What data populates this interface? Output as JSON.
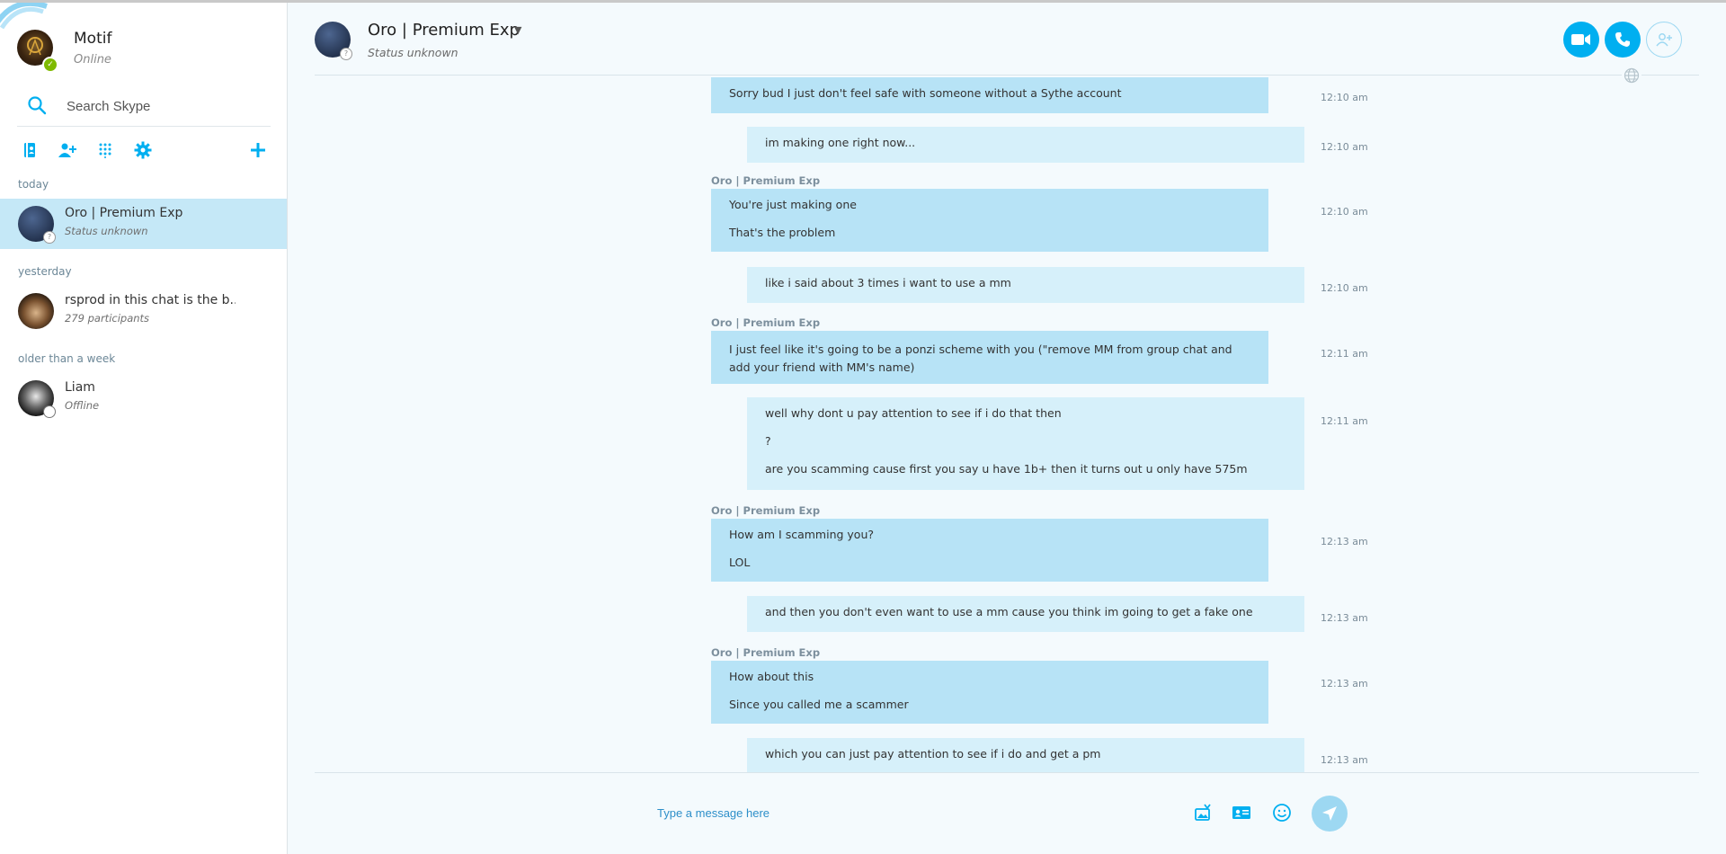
{
  "colors": {
    "accent": "#00aff0",
    "active_row": "#c5e8f7",
    "incoming_bubble": "#b7e3f6",
    "outgoing_bubble": "#d6f0fa",
    "online": "#7fba00"
  },
  "profile": {
    "name": "Motif",
    "status": "Online"
  },
  "search": {
    "placeholder": "Search Skype"
  },
  "toolbar": {
    "icons": [
      "contacts-icon",
      "add-contact-icon",
      "dialpad-icon",
      "settings-icon",
      "plus-icon"
    ]
  },
  "sections": {
    "today": "today",
    "yesterday": "yesterday",
    "older": "older than a week"
  },
  "chats": [
    {
      "name": "Oro | Premium Exp",
      "subtitle": "Status unknown"
    },
    {
      "name": "rsprod in this chat is the b..",
      "subtitle": "279 participants"
    },
    {
      "name": "Liam",
      "subtitle": "Offline"
    }
  ],
  "header": {
    "title": "Oro | Premium Exp",
    "status": "Status unknown"
  },
  "conversation": {
    "sender": "Oro | Premium Exp",
    "messages": [
      {
        "dir": "in",
        "lines": [
          "Sorry bud I just don't feel safe with someone without a Sythe account"
        ],
        "time": "12:10 am"
      },
      {
        "dir": "out",
        "lines": [
          "im making one right now..."
        ],
        "time": "12:10 am"
      },
      {
        "dir": "in",
        "sender": "Oro | Premium Exp",
        "lines": [
          "You're just making one",
          "That's the problem"
        ],
        "time": "12:10 am"
      },
      {
        "dir": "out",
        "lines": [
          "like i said about 3 times i want to use a mm"
        ],
        "time": "12:10 am"
      },
      {
        "dir": "in",
        "sender": "Oro | Premium Exp",
        "lines": [
          "I just feel like it's going to be a ponzi scheme with you (\"remove MM from group chat and add your friend with MM's name)"
        ],
        "time": "12:11 am"
      },
      {
        "dir": "out",
        "lines": [
          "well why dont u pay attention to see if i do that then",
          "?",
          "are you scamming cause first you say u have 1b+ then it turns out u only have 575m"
        ],
        "time": "12:11 am"
      },
      {
        "dir": "in",
        "sender": "Oro | Premium Exp",
        "lines": [
          "How am I scamming you?",
          "LOL"
        ],
        "time": "12:13 am"
      },
      {
        "dir": "out",
        "lines": [
          "and then you don't even want to use a mm cause you think im going to get a fake one"
        ],
        "time": "12:13 am"
      },
      {
        "dir": "in",
        "sender": "Oro | Premium Exp",
        "lines": [
          "How about this",
          "Since you called me a scammer"
        ],
        "time": "12:13 am"
      },
      {
        "dir": "out",
        "lines": [
          "which you can just pay attention to see if i do and get a pm"
        ],
        "time": "12:13 am"
      }
    ]
  },
  "composer": {
    "placeholder": "Type a message here"
  }
}
